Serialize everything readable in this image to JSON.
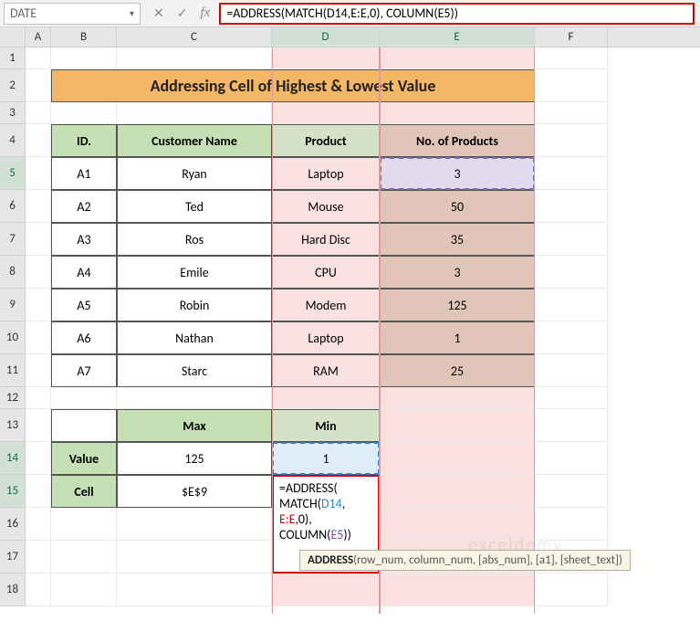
{
  "namebox": "DATE",
  "formula_bar": "=ADDRESS(MATCH(D14,E:E,0), COLUMN(E5))",
  "columns": [
    "A",
    "B",
    "C",
    "D",
    "E",
    "F"
  ],
  "title": "Addressing Cell of Highest & Lowest Value",
  "headers": {
    "id": "ID.",
    "customer": "Customer Name",
    "product": "Product",
    "qty": "No. of Products"
  },
  "rows": [
    {
      "id": "A1",
      "customer": "Ryan",
      "product": "Laptop",
      "qty": "3"
    },
    {
      "id": "A2",
      "customer": "Ted",
      "product": "Mouse",
      "qty": "50"
    },
    {
      "id": "A3",
      "customer": "Ros",
      "product": "Hard Disc",
      "qty": "35"
    },
    {
      "id": "A4",
      "customer": "Emile",
      "product": "CPU",
      "qty": "3"
    },
    {
      "id": "A5",
      "customer": "Robin",
      "product": "Modem",
      "qty": "125"
    },
    {
      "id": "A6",
      "customer": "Nathan",
      "product": "Laptop",
      "qty": "1"
    },
    {
      "id": "A7",
      "customer": "Starc",
      "product": "RAM",
      "qty": "25"
    }
  ],
  "summary": {
    "max_label": "Max",
    "min_label": "Min",
    "value_label": "Value",
    "cell_label": "Cell",
    "max_value": "125",
    "min_value": "1",
    "max_cell": "$E$9"
  },
  "editing_formula": {
    "line1a": "=ADDRESS(",
    "line2a": "MATCH(",
    "line2b": "D14",
    "line2c": ",",
    "line3a": "E:E",
    "line3b": ",0),",
    "line4a": "COLUMN(",
    "line4b": "E5",
    "line4c": "))"
  },
  "tooltip": {
    "fn": "ADDRESS",
    "args": "(row_num, column_num, [abs_num], [a1], [sheet_text])"
  },
  "row_numbers": [
    "1",
    "2",
    "3",
    "4",
    "5",
    "6",
    "7",
    "8",
    "9",
    "10",
    "11",
    "12",
    "13",
    "14",
    "15",
    "16",
    "17",
    "18"
  ],
  "watermark": "exceldemy"
}
